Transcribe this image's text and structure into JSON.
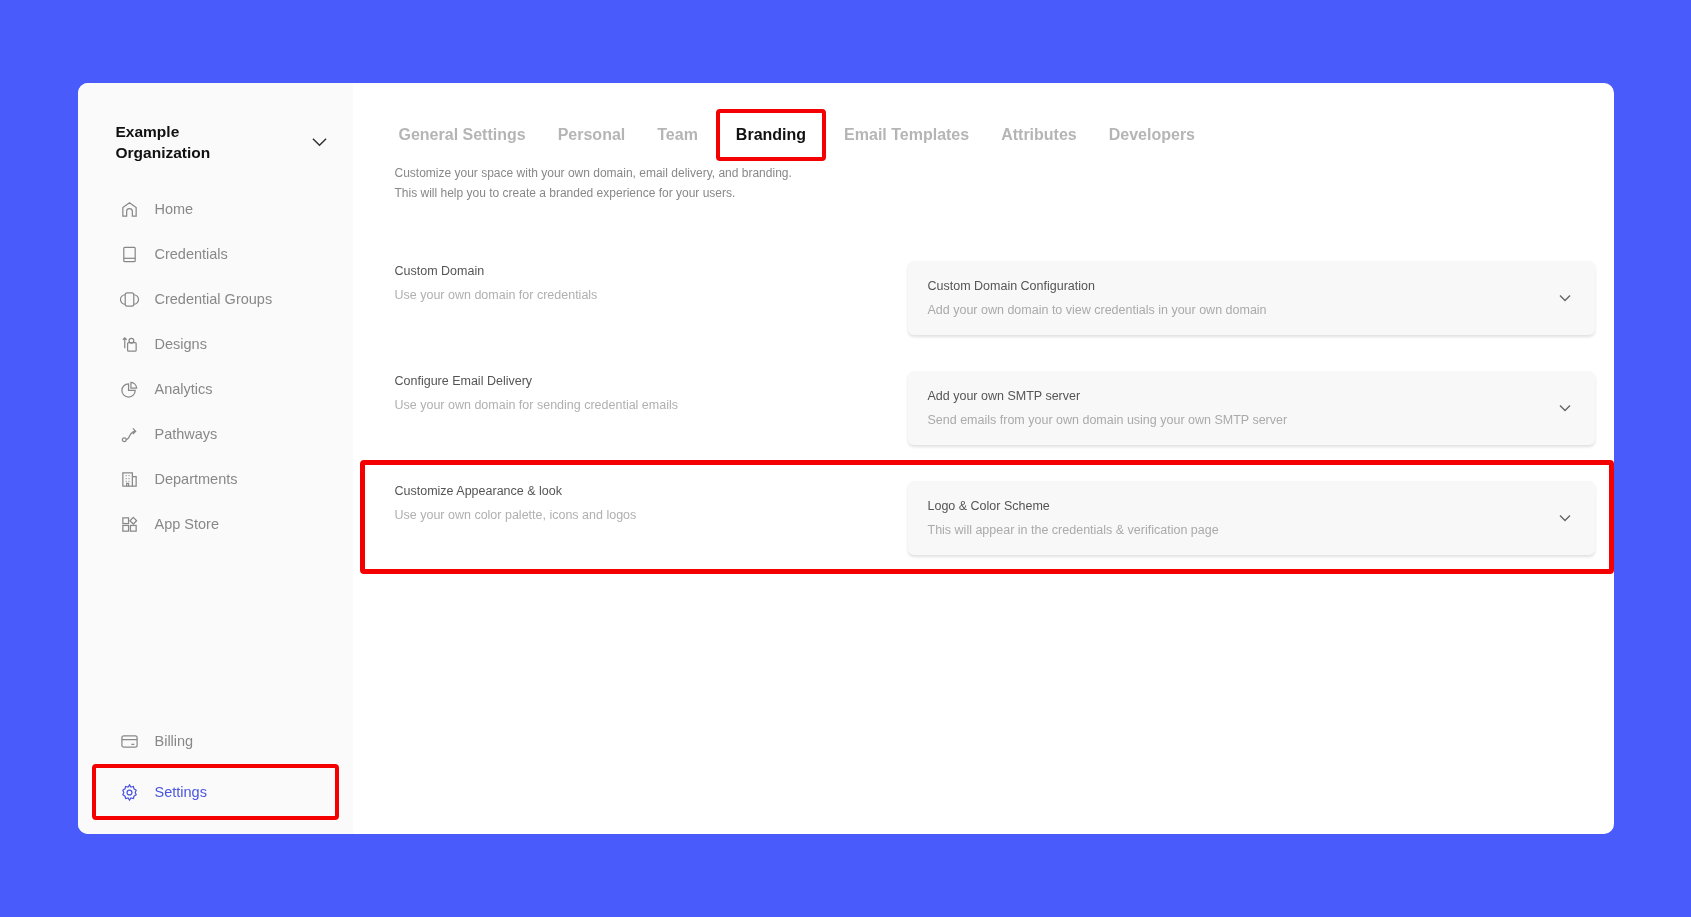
{
  "organization": {
    "name": "Example Organization"
  },
  "nav": [
    {
      "label": "Home",
      "selected": false,
      "highlighted": false
    },
    {
      "label": "Credentials",
      "selected": false,
      "highlighted": false
    },
    {
      "label": "Credential Groups",
      "selected": false,
      "highlighted": false
    },
    {
      "label": "Designs",
      "selected": false,
      "highlighted": false
    },
    {
      "label": "Analytics",
      "selected": false,
      "highlighted": false
    },
    {
      "label": "Pathways",
      "selected": false,
      "highlighted": false
    },
    {
      "label": "Departments",
      "selected": false,
      "highlighted": false
    },
    {
      "label": "App Store",
      "selected": false,
      "highlighted": false
    }
  ],
  "nav_bottom": [
    {
      "label": "Billing",
      "selected": false,
      "highlighted": false
    },
    {
      "label": "Settings",
      "selected": true,
      "highlighted": true
    }
  ],
  "tabs": [
    {
      "label": "General Settings",
      "selected": false,
      "highlighted": false
    },
    {
      "label": "Personal",
      "selected": false,
      "highlighted": false
    },
    {
      "label": "Team",
      "selected": false,
      "highlighted": false
    },
    {
      "label": "Branding",
      "selected": true,
      "highlighted": true
    },
    {
      "label": "Email Templates",
      "selected": false,
      "highlighted": false
    },
    {
      "label": "Attributes",
      "selected": false,
      "highlighted": false
    },
    {
      "label": "Developers",
      "selected": false,
      "highlighted": false
    }
  ],
  "description": [
    "Customize your space with your own domain, email delivery, and branding.",
    "This will help you to create a branded experience for your users."
  ],
  "sections": [
    {
      "title": "Custom Domain",
      "subtitle": "Use your own domain for credentials",
      "card_title": "Custom Domain Configuration",
      "card_subtitle": "Add your own domain to view credentials in your own domain",
      "expanded": false,
      "highlighted": false
    },
    {
      "title": "Configure Email Delivery",
      "subtitle": "Use your own domain for sending credential emails",
      "card_title": "Add your own SMTP server",
      "card_subtitle": "Send emails from your own domain using your own SMTP server",
      "expanded": false,
      "highlighted": false
    },
    {
      "title": "Customize Appearance & look",
      "subtitle": "Use your own color palette, icons and logos",
      "card_title": "Logo & Color Scheme",
      "card_subtitle": "This will appear in the credentials & verification page",
      "expanded": false,
      "highlighted": true
    }
  ]
}
